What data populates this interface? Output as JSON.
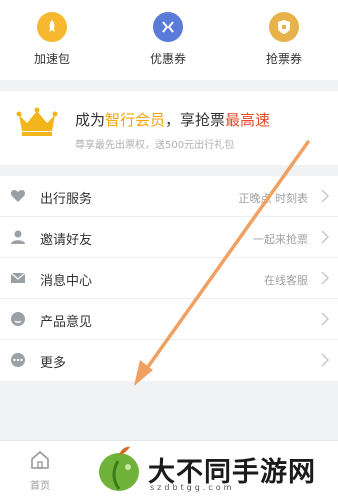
{
  "quick_actions": [
    {
      "label": "加速包",
      "icon": "rocket-icon",
      "color": "#f5b82e"
    },
    {
      "label": "优惠券",
      "icon": "coupon-icon",
      "color": "#5b7bd8"
    },
    {
      "label": "抢票券",
      "icon": "ticket-shield-icon",
      "color": "#e8b24a"
    }
  ],
  "vip": {
    "title_prefix": "成为",
    "title_vip": "智行会员",
    "title_mid": "，享抢票",
    "title_fast": "最高速",
    "subtitle": "尊享最先出票权，送500元出行礼包"
  },
  "menu": [
    {
      "label": "出行服务",
      "hint": "正晚点 时刻表",
      "icon": "heart-icon"
    },
    {
      "label": "邀请好友",
      "hint": "一起来抢票",
      "icon": "user-icon"
    },
    {
      "label": "消息中心",
      "hint": "在线客服",
      "icon": "mail-icon"
    },
    {
      "label": "产品意见",
      "hint": "",
      "icon": "feedback-icon"
    },
    {
      "label": "更多",
      "hint": "",
      "icon": "more-icon"
    }
  ],
  "tabbar": {
    "home_label": "首页"
  },
  "watermark": {
    "text": "大不同手游网",
    "url": "szdbtgg.com"
  },
  "colors": {
    "accent_gold": "#f3a600",
    "accent_red": "#e64b2b",
    "arrow": "#f0a060"
  }
}
